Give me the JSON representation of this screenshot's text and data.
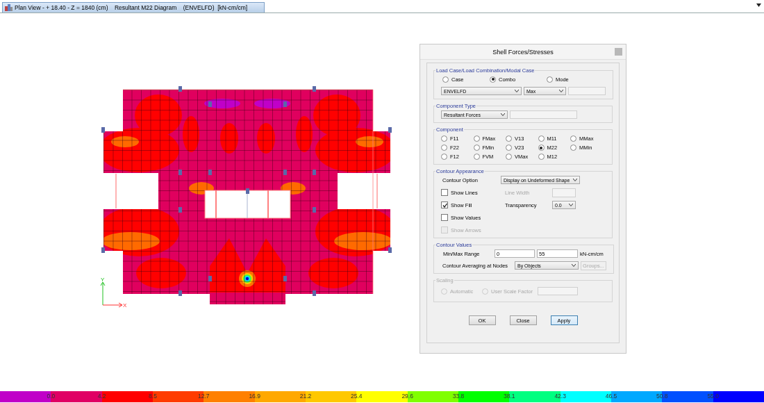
{
  "view_tab": {
    "title": "Plan View - + 18.40 - Z = 1840 (cm)    Resultant M22 Diagram    (ENVELFD)  [kN-cm/cm]"
  },
  "axes": {
    "x_label": "X",
    "y_label": "Y"
  },
  "dialog": {
    "title": "Shell Forces/Stresses",
    "load_case": {
      "legend": "Load Case/Load Combination/Modal Case",
      "options": [
        {
          "label": "Case",
          "selected": false
        },
        {
          "label": "Combo",
          "selected": true
        },
        {
          "label": "Mode",
          "selected": false
        }
      ],
      "case_name": "ENVELFD",
      "envelope": "Max"
    },
    "component_type": {
      "legend": "Component Type",
      "value": "Resultant Forces"
    },
    "component": {
      "legend": "Component",
      "options": [
        {
          "label": "F11",
          "selected": false
        },
        {
          "label": "FMax",
          "selected": false
        },
        {
          "label": "V13",
          "selected": false
        },
        {
          "label": "M11",
          "selected": false
        },
        {
          "label": "MMax",
          "selected": false
        },
        {
          "label": "F22",
          "selected": false
        },
        {
          "label": "FMin",
          "selected": false
        },
        {
          "label": "V23",
          "selected": false
        },
        {
          "label": "M22",
          "selected": true
        },
        {
          "label": "MMin",
          "selected": false
        },
        {
          "label": "F12",
          "selected": false
        },
        {
          "label": "FVM",
          "selected": false
        },
        {
          "label": "VMax",
          "selected": false
        },
        {
          "label": "M12",
          "selected": false
        }
      ]
    },
    "contour_appearance": {
      "legend": "Contour Appearance",
      "contour_option_label": "Contour Option",
      "contour_option": "Display on Undeformed Shape",
      "checks": [
        {
          "label": "Show Lines",
          "checked": false,
          "disabled": false
        },
        {
          "label": "Show Fill",
          "checked": true,
          "disabled": false
        },
        {
          "label": "Show Values",
          "checked": false,
          "disabled": false
        },
        {
          "label": "Show Arrows",
          "checked": false,
          "disabled": true
        }
      ],
      "line_width": {
        "label": "Line Width",
        "disabled": true
      },
      "transparency_label": "Transparency",
      "transparency": "0.0"
    },
    "contour_values": {
      "legend": "Contour Values",
      "range_label": "Min/Max Range",
      "min": "0",
      "max": "55",
      "units": "kN-cm/cm",
      "averaging_label": "Contour Averaging at Nodes",
      "averaging": "By Objects",
      "groups_button": {
        "label": "Groups...",
        "disabled": true
      }
    },
    "scaling": {
      "legend": "Scaling",
      "disabled": true,
      "options": [
        {
          "label": "Automatic",
          "selected": false
        },
        {
          "label": "User Scale Factor",
          "selected": false
        }
      ]
    },
    "buttons": [
      {
        "label": "OK",
        "focused": false
      },
      {
        "label": "Close",
        "focused": false
      },
      {
        "label": "Apply",
        "focused": true
      }
    ]
  },
  "legend": {
    "bands": [
      {
        "color": "#c000c8"
      },
      {
        "color": "#e00064"
      },
      {
        "color": "#ff0000"
      },
      {
        "color": "#ff3c00"
      },
      {
        "color": "#ff8000"
      },
      {
        "color": "#ffa800"
      },
      {
        "color": "#ffc800"
      },
      {
        "color": "#ffff00"
      },
      {
        "color": "#80ff00"
      },
      {
        "color": "#00ff00"
      },
      {
        "color": "#00ff80"
      },
      {
        "color": "#00ffff"
      },
      {
        "color": "#00a8ff"
      },
      {
        "color": "#0050ff"
      },
      {
        "color": "#0000ff"
      }
    ],
    "ticks": [
      "0.0",
      "4.2",
      "8.5",
      "12.7",
      "16.9",
      "21.2",
      "25.4",
      "29.6",
      "33.8",
      "38.1",
      "42.3",
      "46.5",
      "50.8",
      "55.0"
    ]
  }
}
